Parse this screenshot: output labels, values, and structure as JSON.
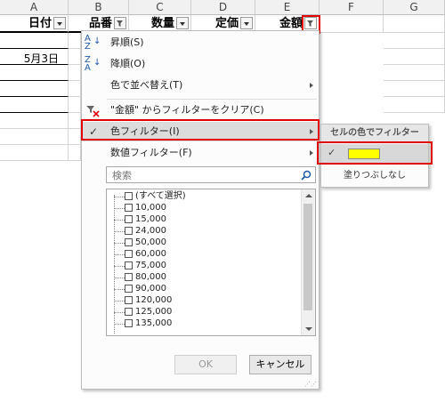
{
  "columns": [
    "A",
    "B",
    "C",
    "D",
    "E",
    "F",
    "G"
  ],
  "header_row": {
    "date": "日付",
    "item": "品番",
    "qty": "数量",
    "price": "定価",
    "amount": "金額"
  },
  "cells": {
    "a3": "5月3日"
  },
  "menu": {
    "sort_asc": "昇順(S)",
    "sort_desc": "降順(O)",
    "sort_by_color": "色で並べ替え(T)",
    "clear_filter": "\"金額\" からフィルターをクリア(C)",
    "color_filter": "色フィルター(I)",
    "number_filter": "数値フィルター(F)",
    "search_placeholder": "検索",
    "values": [
      "(すべて選択)",
      "10,000",
      "15,000",
      "24,000",
      "50,000",
      "60,000",
      "75,000",
      "80,000",
      "90,000",
      "120,000",
      "125,000",
      "135,000"
    ],
    "ok": "OK",
    "cancel": "キャンセル"
  },
  "submenu": {
    "title": "セルの色でフィルター",
    "swatch_color": "#ffff00",
    "no_fill": "塗りつぶしなし"
  },
  "colors": {
    "highlight": "#e00000",
    "accent_icon": "#1e5aa8"
  }
}
